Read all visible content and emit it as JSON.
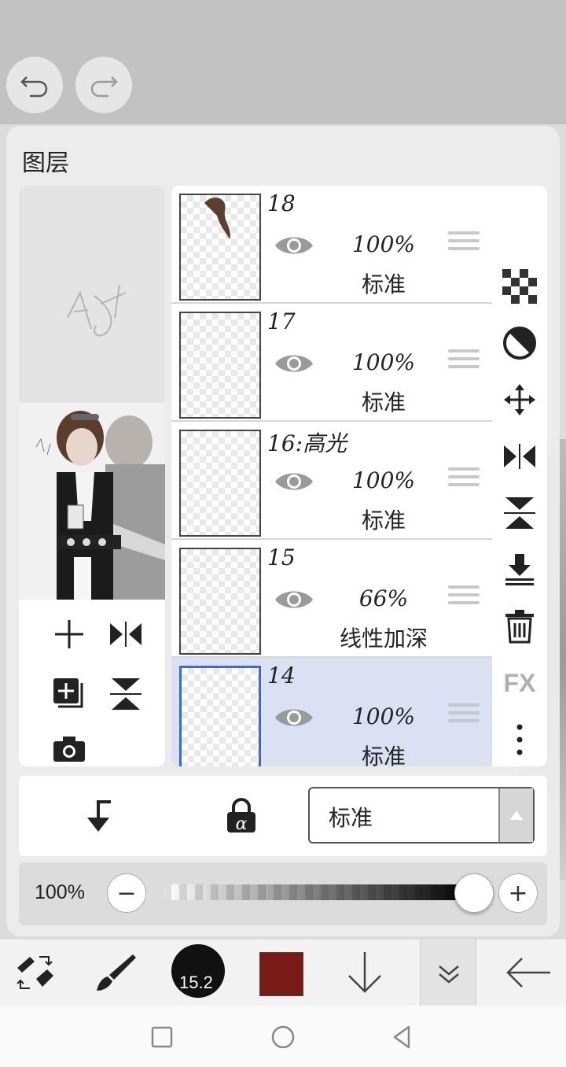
{
  "panel": {
    "title": "图层"
  },
  "layers": [
    {
      "name": "18",
      "opacity": "100%",
      "blend": "标准",
      "selected": false
    },
    {
      "name": "17",
      "opacity": "100%",
      "blend": "标准",
      "selected": false
    },
    {
      "name": "16:高光",
      "opacity": "100%",
      "blend": "标准",
      "selected": false
    },
    {
      "name": "15",
      "opacity": "66%",
      "blend": "线性加深",
      "selected": false
    },
    {
      "name": "14",
      "opacity": "100%",
      "blend": "标准",
      "selected": true
    }
  ],
  "blend_bar": {
    "mode": "标准"
  },
  "opacity_bar": {
    "label": "100%",
    "value": 1.0
  },
  "right_tools": [
    "checker-icon",
    "circle-half-icon",
    "move-icon",
    "flip-horizontal-icon",
    "flip-vertical-icon",
    "merge-down-icon",
    "trash-icon",
    "fx-icon",
    "more-icon"
  ],
  "right_tool_fx_label": "FX",
  "toolbar": {
    "brush_size": "15.2",
    "color": "#7a1a17"
  },
  "colors": {
    "selected_layer_bg": "#dbe1f2",
    "selected_border": "#3c6cc8"
  }
}
